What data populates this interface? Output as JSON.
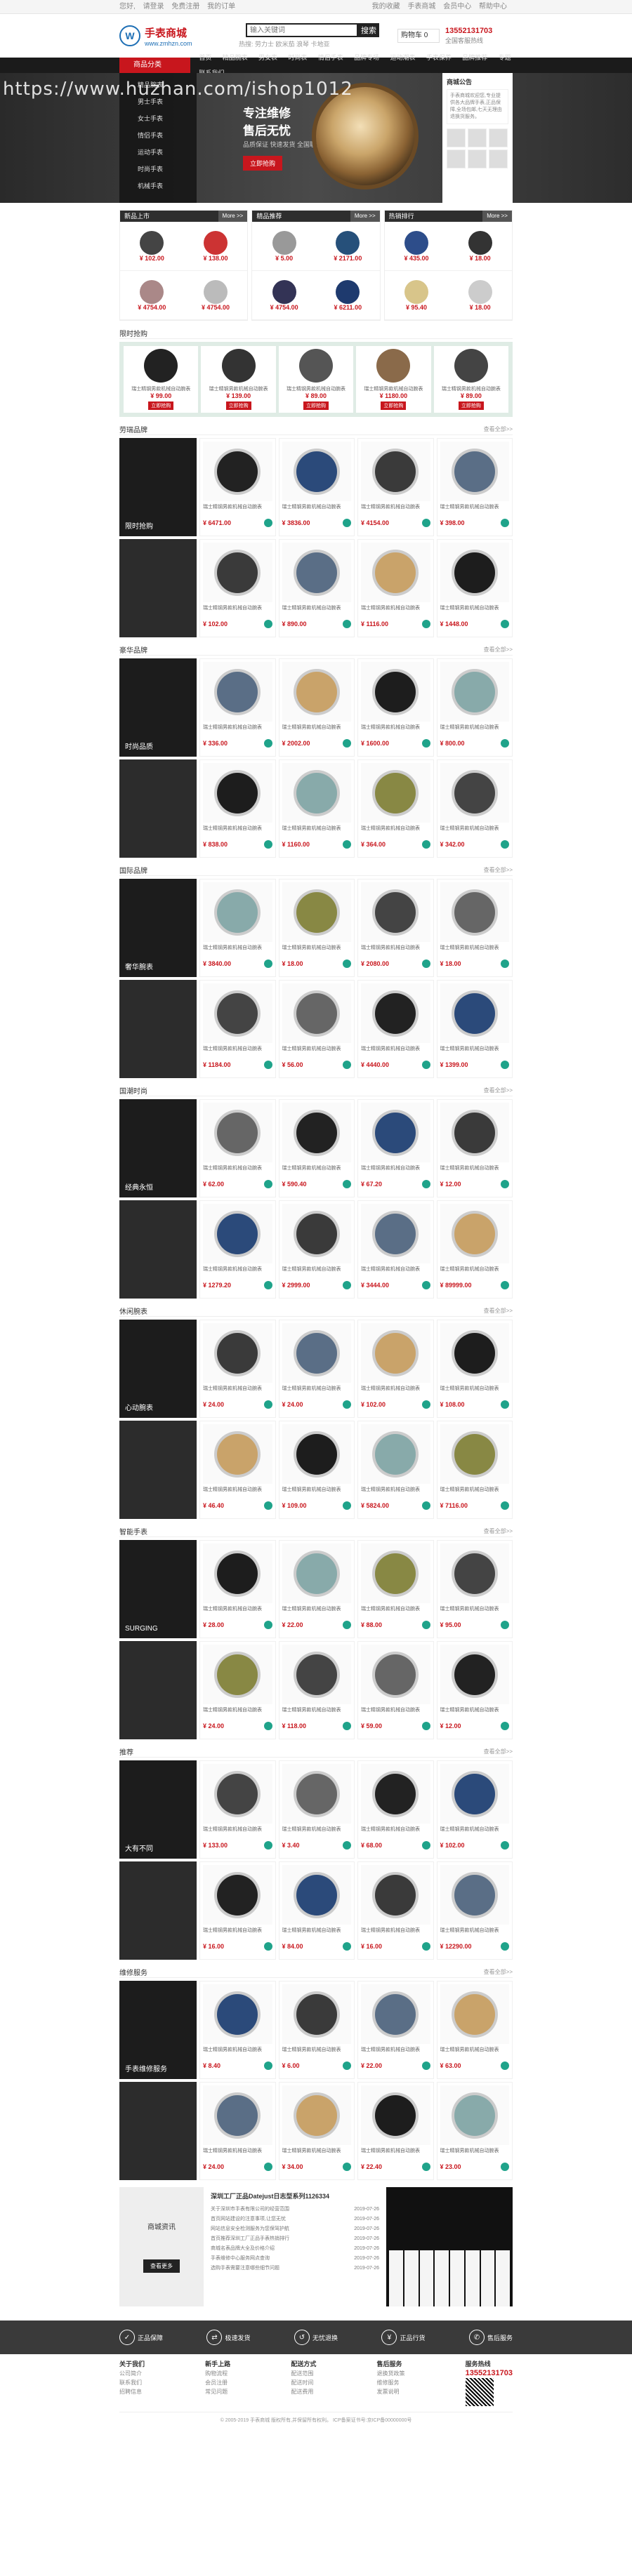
{
  "topbar": {
    "left": [
      "您好,",
      "请登录",
      "免费注册",
      "我的订单"
    ],
    "right": [
      "我的收藏",
      "手表商城",
      "会员中心",
      "帮助中心"
    ]
  },
  "header": {
    "logo_name": "手表商城",
    "logo_url": "www.zmhzn.com",
    "search_placeholder": "输入关键词",
    "search_btn": "搜索",
    "hot": "热搜: 劳力士 欧米茄 浪琴 卡地亚",
    "cart": "购物车 0",
    "phone": "13552131703",
    "phone_label": "全国客服热线"
  },
  "nav": {
    "cat": "商品分类",
    "items": [
      "首页",
      "精品腕表",
      "男女表",
      "时尚表",
      "情侣手表",
      "品牌专场",
      "运动潮表",
      "手表保养",
      "品牌推荐",
      "专题",
      "联系我们"
    ]
  },
  "hero": {
    "watermark": "https://www.huzhan.com/ishop1012",
    "slogan1": "专注维修",
    "slogan2": "售后无忧",
    "desc": "品质保证 快速发货 全国联保",
    "btn": "立即抢购",
    "side_title": "商城公告",
    "side_text": "手表商城欢迎您,专业提供各大品牌手表,正品保障,全场包邮,七天无理由退换货服务。",
    "cats": [
      "精品腕表",
      "男士手表",
      "女士手表",
      "情侣手表",
      "运动手表",
      "时尚手表",
      "机械手表"
    ]
  },
  "tri": [
    {
      "title": "新品上市",
      "more": "More >>",
      "items": [
        {
          "p": "¥ 102.00"
        },
        {
          "p": "¥ 138.00"
        },
        {
          "p": "¥ 4754.00"
        },
        {
          "p": "¥ 4754.00"
        }
      ]
    },
    {
      "title": "精品推荐",
      "more": "More >>",
      "items": [
        {
          "p": "¥ 5.00"
        },
        {
          "p": "¥ 2171.00"
        },
        {
          "p": "¥ 4754.00"
        },
        {
          "p": "¥ 6211.00"
        }
      ]
    },
    {
      "title": "热销排行",
      "more": "More >>",
      "items": [
        {
          "p": "¥ 435.00"
        },
        {
          "p": "¥ 18.00"
        },
        {
          "p": "¥ 95.40"
        },
        {
          "p": "¥ 18.00"
        }
      ]
    }
  ],
  "special": {
    "title": "限时抢购",
    "tag": "立即抢购",
    "items": [
      {
        "nm": "瑞士精钢男款机械自动腕表",
        "p": "¥ 99.00"
      },
      {
        "nm": "瑞士精钢男款机械自动腕表",
        "p": "¥ 139.00"
      },
      {
        "nm": "瑞士精钢男款机械自动腕表",
        "p": "¥ 89.00"
      },
      {
        "nm": "瑞士精钢男款机械自动腕表",
        "p": "¥ 1180.00"
      },
      {
        "nm": "瑞士精钢男款机械自动腕表",
        "p": "¥ 89.00"
      }
    ]
  },
  "brands": [
    {
      "title": "劳瑞品牌",
      "more": "查看全部>>",
      "promo": "限时抢购",
      "rows": [
        [
          {
            "p": "¥ 6471.00"
          },
          {
            "p": "¥ 3836.00"
          },
          {
            "p": "¥ 4154.00"
          },
          {
            "p": "¥ 398.00"
          }
        ],
        [
          {
            "p": "¥ 102.00"
          },
          {
            "p": "¥ 890.00"
          },
          {
            "p": "¥ 1116.00"
          },
          {
            "p": "¥ 1448.00"
          }
        ]
      ]
    },
    {
      "title": "豪华品牌",
      "more": "查看全部>>",
      "promo": "时尚品质",
      "rows": [
        [
          {
            "p": "¥ 336.00"
          },
          {
            "p": "¥ 2002.00"
          },
          {
            "p": "¥ 1600.00"
          },
          {
            "p": "¥ 800.00"
          }
        ],
        [
          {
            "p": "¥ 838.00"
          },
          {
            "p": "¥ 1160.00"
          },
          {
            "p": "¥ 364.00"
          },
          {
            "p": "¥ 342.00"
          }
        ]
      ]
    },
    {
      "title": "国际品牌",
      "more": "查看全部>>",
      "promo": "奢华腕表",
      "rows": [
        [
          {
            "p": "¥ 3840.00"
          },
          {
            "p": "¥ 18.00"
          },
          {
            "p": "¥ 2080.00"
          },
          {
            "p": "¥ 18.00"
          }
        ],
        [
          {
            "p": "¥ 1184.00"
          },
          {
            "p": "¥ 56.00"
          },
          {
            "p": "¥ 4440.00"
          },
          {
            "p": "¥ 1399.00"
          }
        ]
      ]
    },
    {
      "title": "国潮时尚",
      "more": "查看全部>>",
      "promo": "经典永恒",
      "rows": [
        [
          {
            "p": "¥ 62.00"
          },
          {
            "p": "¥ 590.40"
          },
          {
            "p": "¥ 67.20"
          },
          {
            "p": "¥ 12.00"
          }
        ],
        [
          {
            "p": "¥ 1279.20"
          },
          {
            "p": "¥ 2999.00"
          },
          {
            "p": "¥ 3444.00"
          },
          {
            "p": "¥ 89999.00"
          }
        ]
      ]
    },
    {
      "title": "休闲腕表",
      "more": "查看全部>>",
      "promo": "心动腕表",
      "rows": [
        [
          {
            "p": "¥ 24.00"
          },
          {
            "p": "¥ 24.00"
          },
          {
            "p": "¥ 102.00"
          },
          {
            "p": "¥ 108.00"
          }
        ],
        [
          {
            "p": "¥ 46.40"
          },
          {
            "p": "¥ 109.00"
          },
          {
            "p": "¥ 5824.00"
          },
          {
            "p": "¥ 7116.00"
          }
        ]
      ]
    },
    {
      "title": "智能手表",
      "more": "查看全部>>",
      "promo": "SURGING",
      "rows": [
        [
          {
            "p": "¥ 28.00"
          },
          {
            "p": "¥ 22.00"
          },
          {
            "p": "¥ 88.00"
          },
          {
            "p": "¥ 95.00"
          }
        ],
        [
          {
            "p": "¥ 24.00"
          },
          {
            "p": "¥ 118.00"
          },
          {
            "p": "¥ 59.00"
          },
          {
            "p": "¥ 12.00"
          }
        ]
      ]
    },
    {
      "title": "推荐",
      "more": "查看全部>>",
      "promo": "大有不同",
      "rows": [
        [
          {
            "p": "¥ 133.00"
          },
          {
            "p": "¥ 3.40"
          },
          {
            "p": "¥ 68.00"
          },
          {
            "p": "¥ 102.00"
          }
        ],
        [
          {
            "p": "¥ 16.00"
          },
          {
            "p": "¥ 84.00"
          },
          {
            "p": "¥ 16.00"
          },
          {
            "p": "¥ 12290.00"
          }
        ]
      ]
    },
    {
      "title": "维修服务",
      "more": "查看全部>>",
      "promo": "手表维修服务",
      "rows": [
        [
          {
            "p": "¥ 8.40"
          },
          {
            "p": "¥ 6.00"
          },
          {
            "p": "¥ 22.00"
          },
          {
            "p": "¥ 63.00"
          }
        ],
        [
          {
            "p": "¥ 24.00"
          },
          {
            "p": "¥ 34.00"
          },
          {
            "p": "¥ 22.40"
          },
          {
            "p": "¥ 23.00"
          }
        ]
      ]
    }
  ],
  "bottom": {
    "left_title": "商城资讯",
    "left_btn": "查看更多",
    "news_title": "深圳工厂正品Datejust日志型系列1126334",
    "news": [
      {
        "t": "关于深圳市手表有限公司的经营范围",
        "d": "2019-07-26"
      },
      {
        "t": "首页网站建设的注意事项,让您无忧",
        "d": "2019-07-26"
      },
      {
        "t": "网站信息安全检测服务为您保驾护航",
        "d": "2019-07-26"
      },
      {
        "t": "首页推荐深圳工厂正品手表热销排行",
        "d": "2019-07-26"
      },
      {
        "t": "商城名表品牌大全及价格介绍",
        "d": "2019-07-26"
      },
      {
        "t": "手表维修中心服务网点查询",
        "d": "2019-07-26"
      },
      {
        "t": "选购手表需要注意哪些细节问题",
        "d": "2019-07-26"
      }
    ]
  },
  "footer": {
    "svc": [
      "正品保障",
      "极速发货",
      "无忧退换",
      "正品行货",
      "售后服务"
    ],
    "cols": [
      {
        "h": "关于我们",
        "l": [
          "公司简介",
          "联系我们",
          "招聘信息"
        ]
      },
      {
        "h": "新手上路",
        "l": [
          "购物流程",
          "会员注册",
          "常见问题"
        ]
      },
      {
        "h": "配送方式",
        "l": [
          "配送范围",
          "配送时间",
          "配送费用"
        ]
      },
      {
        "h": "售后服务",
        "l": [
          "退换货政策",
          "维修服务",
          "发票说明"
        ]
      },
      {
        "h": "服务热线",
        "l": [
          "13552131703"
        ]
      }
    ],
    "copy": "© 2005-2019 手表商城 版权所有,并保留所有权利。 ICP备案证书号:京ICP备00000000号"
  }
}
